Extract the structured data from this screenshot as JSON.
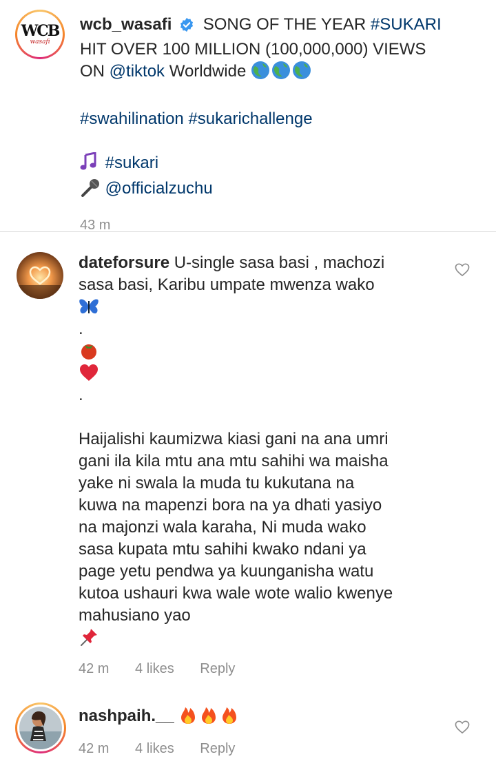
{
  "post": {
    "username": "wcb_wasafi",
    "logo": {
      "mark": "WCB",
      "sub": "wasafi"
    },
    "caption_head": "SONG OF THE YEAR",
    "hashtag_sukari": "#SUKARI",
    "caption_line2": "HIT OVER 100 MILLION (100,000,000) VIEWS",
    "caption_line3_pre": "ON",
    "mention_tiktok": "@tiktok",
    "caption_line3_post": "Worldwide",
    "hashtags_line": [
      "#swahilination",
      "#sukarichallenge"
    ],
    "music_tag": "#sukari",
    "mic_mention": "@officialzuchu",
    "time": "43 m",
    "icons": {
      "verified": "verified-badge-icon",
      "globe": "globe-emoji",
      "music": "music-notes-emoji",
      "mic": "microphone-emoji"
    }
  },
  "comments": [
    {
      "username": "dateforsure",
      "line1": "U-single sasa basi , machozi",
      "line2": "sasa basi,  Karibu umpate mwenza wako",
      "dot1": ".",
      "dot2": ".",
      "paragraph": [
        "Haijalishi kaumizwa kiasi gani na ana umri",
        "gani ila kila mtu ana mtu sahihi wa maisha",
        "yake ni swala la muda tu kukutana na",
        "kuwa na mapenzi bora na ya dhati yasiyo",
        "na majonzi wala karaha, Ni muda wako",
        "sasa kupata mtu sahihi kwako ndani ya",
        "page yetu pendwa ya kuunganisha watu",
        "kutoa ushauri kwa wale wote walio kwenye",
        "mahusiano yao"
      ],
      "time": "42 m",
      "likes": "4 likes",
      "reply": "Reply"
    },
    {
      "username": "nashpaih.__",
      "time": "42 m",
      "likes": "4 likes",
      "reply": "Reply"
    }
  ],
  "colors": {
    "link": "#00376b",
    "meta": "#8e8e8e",
    "verified": "#3897f0",
    "divider": "#dbdbdb"
  }
}
